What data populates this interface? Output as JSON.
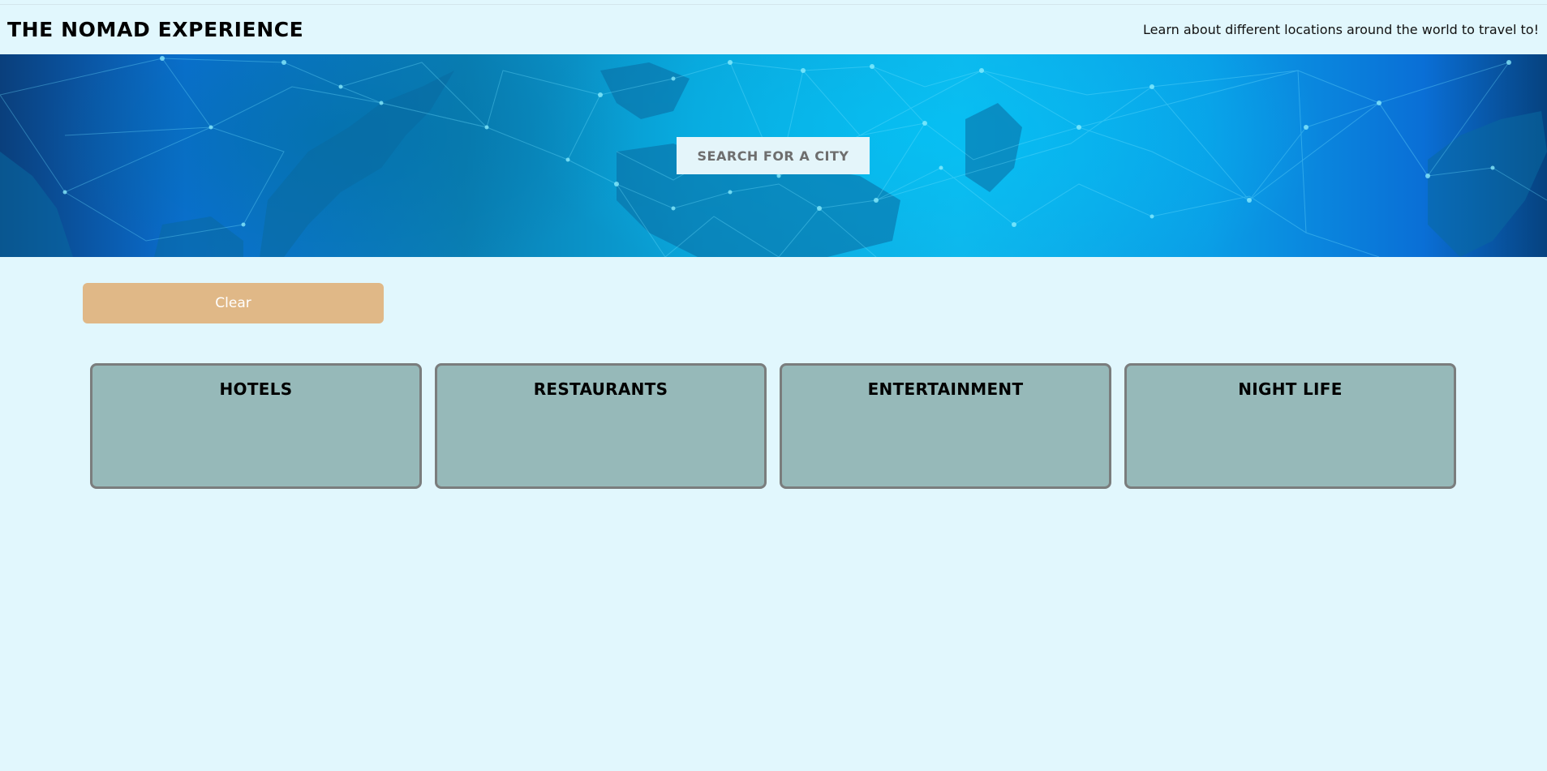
{
  "header": {
    "title": "THE NOMAD EXPERIENCE",
    "tagline": "Learn about different locations around the world to travel to!"
  },
  "hero": {
    "background": "world-map-network-image",
    "search_placeholder": "SEARCH FOR A CITY"
  },
  "controls": {
    "clear_label": "Clear"
  },
  "categories": [
    {
      "label": "HOTELS"
    },
    {
      "label": "RESTAURANTS"
    },
    {
      "label": "ENTERTAINMENT"
    },
    {
      "label": "NIGHT LIFE"
    }
  ],
  "colors": {
    "page_background": "#e1f7fd",
    "clear_button": "#e0b887",
    "card_background": "#96b9b9",
    "card_border": "#7a7d7d"
  }
}
